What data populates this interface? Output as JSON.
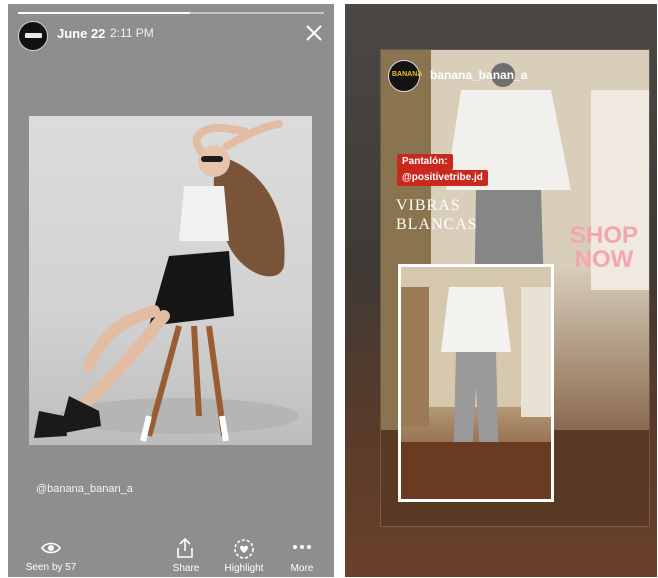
{
  "left_story": {
    "date": "June 22",
    "time": "2:11 PM",
    "mention": "@banana_banan_a",
    "bottom_bar": {
      "seen_label": "Seen by 57",
      "share_label": "Share",
      "highlight_label": "Highlight",
      "more_label": "More"
    }
  },
  "right_story": {
    "username": "banana_banan_a",
    "avatar_text": "BANANA",
    "tag_line1": "Pantalón:",
    "tag_line2": "@positivetribe.jd",
    "vibras_line1": "VIBRAS",
    "vibras_line2": "BLANCAS",
    "shop_line1": "SHOP",
    "shop_line2": "NOW"
  },
  "colors": {
    "left_background": "#8e8e8e",
    "tag_red": "#c8281e",
    "shop_pink": "#f3a6b2"
  },
  "icons": [
    "close-icon",
    "eye-icon",
    "share-icon",
    "highlight-icon",
    "more-icon"
  ]
}
